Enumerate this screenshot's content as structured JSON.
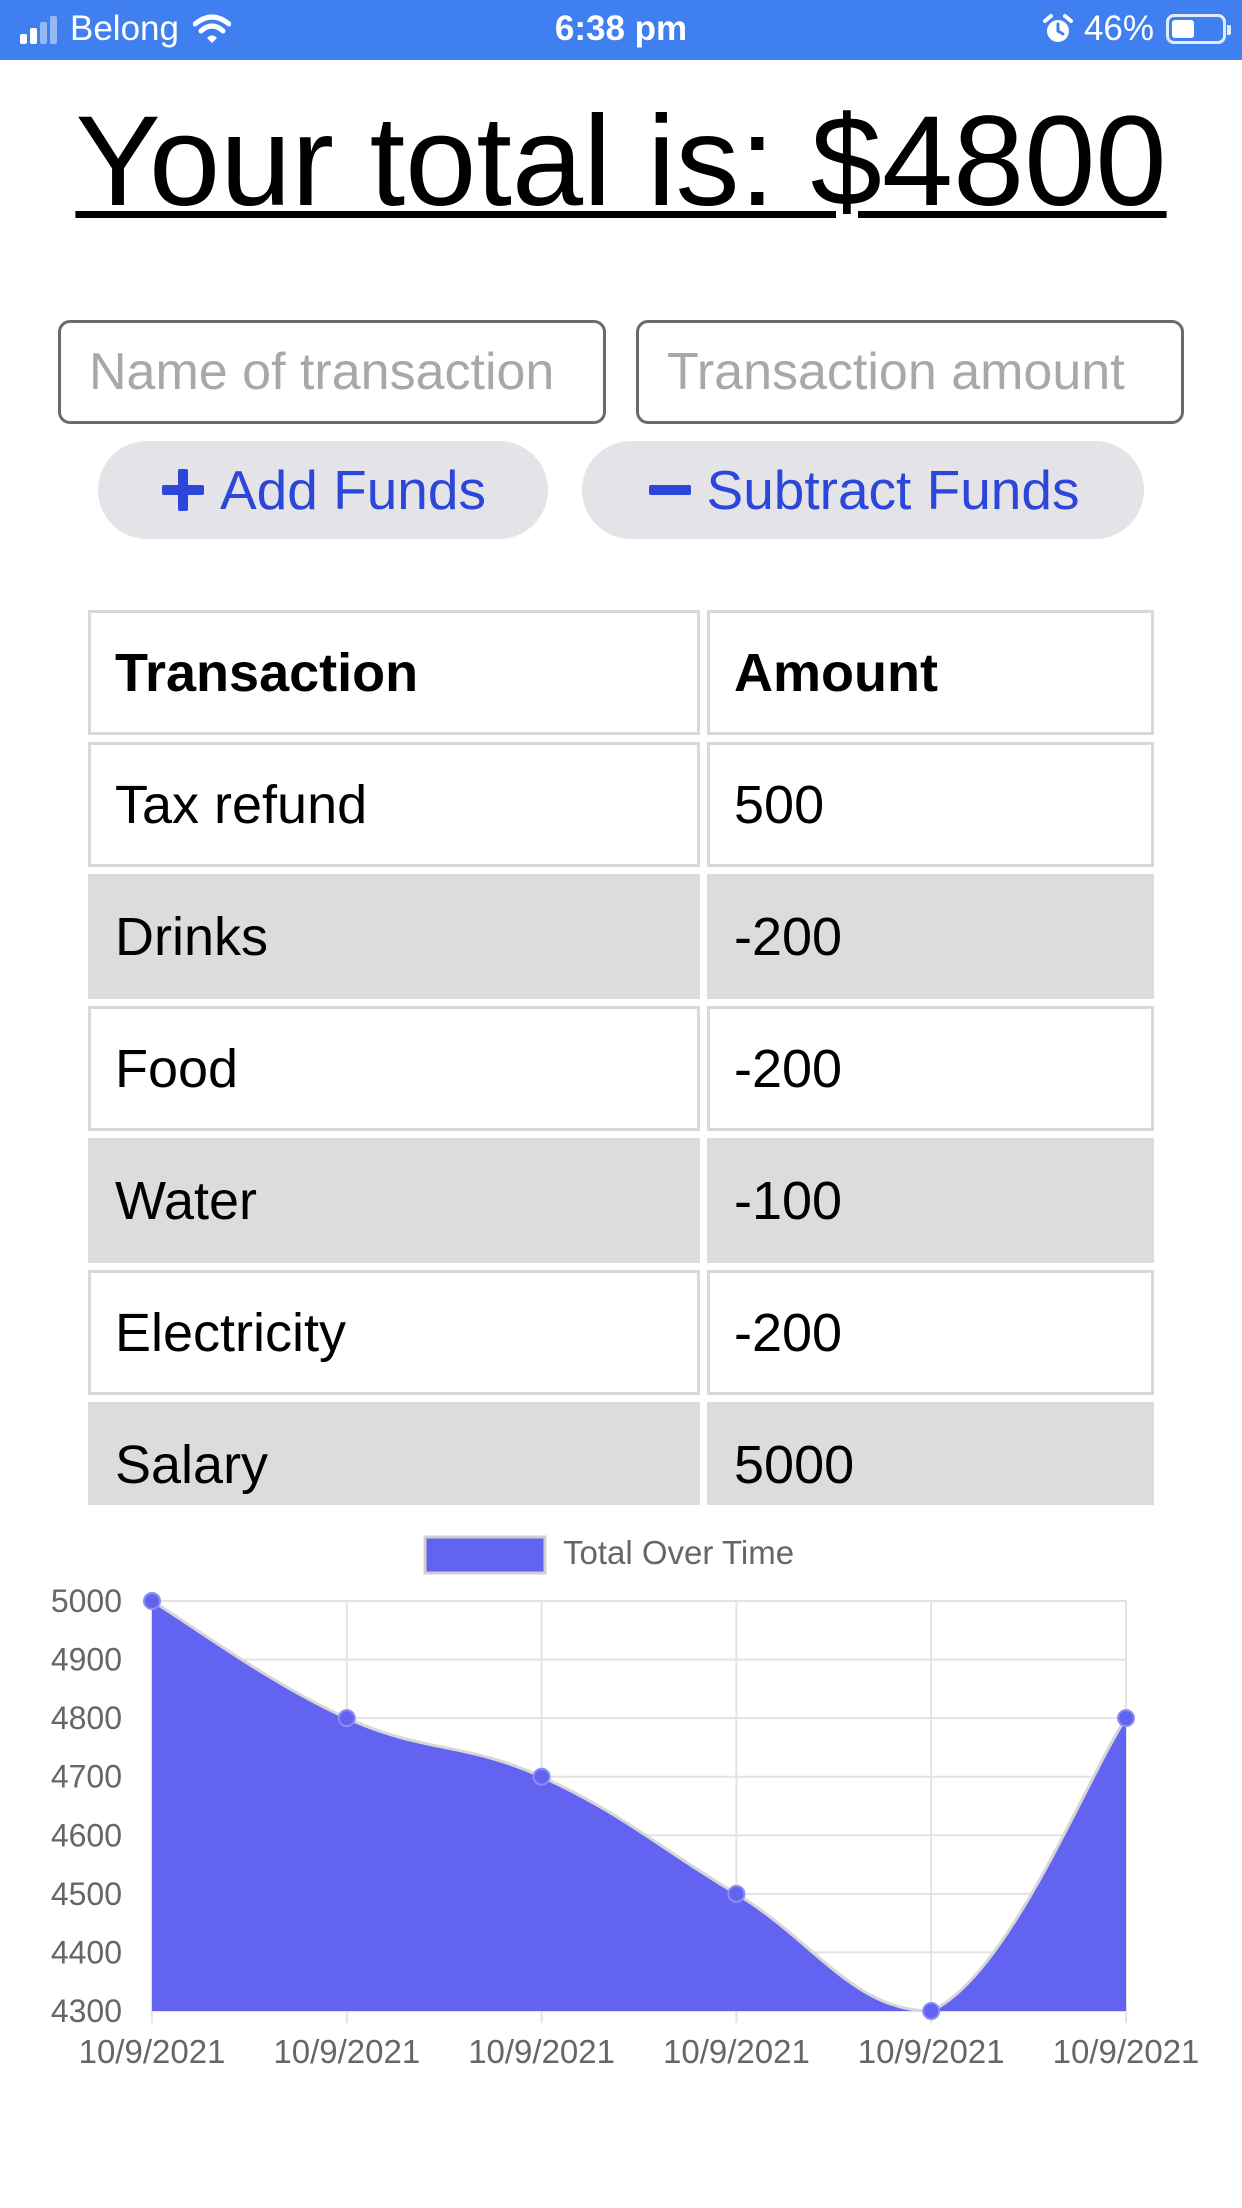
{
  "status_bar": {
    "carrier": "Belong",
    "time": "6:38 pm",
    "battery": "46%",
    "battery_level": 0.46,
    "icons": [
      "signal-icon",
      "wifi-icon",
      "alarm-icon",
      "battery-icon"
    ]
  },
  "total": {
    "text": "Your total is: $4800"
  },
  "form": {
    "name_placeholder": "Name of transaction",
    "amount_placeholder": "Transaction amount",
    "add_label": "Add Funds",
    "subtract_label": "Subtract Funds"
  },
  "table": {
    "headers": [
      "Transaction",
      "Amount"
    ],
    "rows": [
      [
        "Tax refund",
        "500"
      ],
      [
        "Drinks",
        "-200"
      ],
      [
        "Food",
        "-200"
      ],
      [
        "Water",
        "-100"
      ],
      [
        "Electricity",
        "-200"
      ],
      [
        "Salary",
        "5000"
      ]
    ]
  },
  "colors": {
    "status_bar": "#3f7ff0",
    "button_text": "#2b46d8",
    "button_bg": "#e3e3e8",
    "chart_fill": "#6263f1",
    "shaded_row": "#dcdcdc"
  },
  "chart_data": {
    "type": "area",
    "legend": "Total Over Time",
    "legend_position": "top-center",
    "grid": true,
    "x": [
      "10/9/2021",
      "10/9/2021",
      "10/9/2021",
      "10/9/2021",
      "10/9/2021",
      "10/9/2021"
    ],
    "series": [
      {
        "name": "Total Over Time",
        "values": [
          5000,
          4800,
          4700,
          4500,
          4300,
          4800
        ]
      }
    ],
    "ylim": [
      4300,
      5000
    ],
    "yticks": [
      5000,
      4900,
      4800,
      4700,
      4600,
      4500,
      4400,
      4300
    ]
  }
}
